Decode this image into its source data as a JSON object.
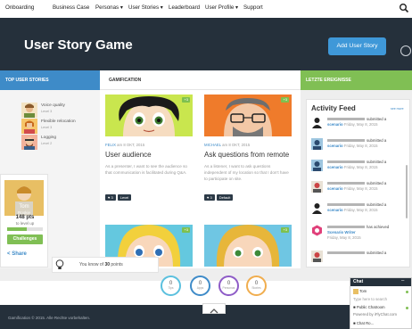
{
  "nav": {
    "items": [
      "Onboarding",
      "Business Case",
      "Personas ▾",
      "User Stories ▾",
      "Leaderboard",
      "User Profile ▾",
      "Support"
    ]
  },
  "header": {
    "title": "User Story Game",
    "add_button": "Add User Story"
  },
  "columns": {
    "left": "TOP USER STORIES",
    "middle": "GAMIFICATION",
    "right": "LETZTE EREIGNISSE"
  },
  "top_stories": [
    {
      "name": "Voice quality",
      "sub": "Level 3"
    },
    {
      "name": "Flexible relocation",
      "sub": "Level 3"
    },
    {
      "name": "Logging",
      "sub": "Level 2"
    }
  ],
  "profile": {
    "name": "Tom",
    "rank": "Rookie",
    "points": "148 pts",
    "points_sub": "to level up",
    "progress": 0.55,
    "challenges": "Challenges",
    "share": "Share"
  },
  "cards": [
    {
      "badge": "+3",
      "author": "FELIX",
      "date": "am 8 OKT, 2015",
      "title": "User audience",
      "desc": "As a presenter, I want to see the audience so that communication is facilitated during Q&A.",
      "pills": [
        "♥ 3",
        "Level"
      ]
    },
    {
      "badge": "+3",
      "author": "MICHAEL",
      "date": "am 8 OKT, 2015",
      "title": "Ask questions from remote",
      "desc": "As a listener, I want to ask questions independent of my location so that I don't have to participate on site.",
      "pills": [
        "♥ 3",
        "Default"
      ]
    },
    {
      "badge": "+3"
    },
    {
      "badge": "+3"
    }
  ],
  "feed": {
    "title": "Activity Feed",
    "see_all": "see more",
    "rows": [
      {
        "verb": "submitted",
        "tail": "a",
        "what": "scenario",
        "when": "Friday, May 8, 2015"
      },
      {
        "verb": "submitted",
        "tail": "a",
        "what": "scenario",
        "when": "Friday, May 8, 2015"
      },
      {
        "verb": "submitted",
        "tail": "a",
        "what": "scenario",
        "when": "Friday, May 8, 2015"
      },
      {
        "verb": "submitted",
        "tail": "a",
        "what": "scenario",
        "when": "Friday, May 8, 2015"
      },
      {
        "verb": "submitted",
        "tail": "a",
        "what": "scenario",
        "when": "Friday, May 8, 2015"
      },
      {
        "verb": "has achieved",
        "tail": "",
        "what": "Scenario Writer",
        "when": "Friday, May 8, 2015"
      },
      {
        "verb": "submitted",
        "tail": "a",
        "what": "",
        "when": ""
      }
    ]
  },
  "tooltip": {
    "prefix": "You know of",
    "value": "30",
    "suffix": "points"
  },
  "stats": [
    {
      "n": "0",
      "label": "Tips",
      "color": "#5bc0de"
    },
    {
      "n": "0",
      "label": "Apps",
      "color": "#3e8bc8"
    },
    {
      "n": "0",
      "label": "Personas",
      "color": "#8e5cc7"
    },
    {
      "n": "0",
      "label": "Stories",
      "color": "#f0ad4e"
    }
  ],
  "footer": {
    "copyright": "Gamification © 2015. Alle Rechte vorbehalten."
  },
  "chat": {
    "title": "Chat",
    "minimize": "–",
    "user": "Tom",
    "search": "Type here to search",
    "room": "Public Chatroom",
    "powered": "Powered by iFlyChat.com",
    "footer_text": "Chat Ro..."
  },
  "colors": {
    "header": "#25303b",
    "left_head": "#3e8bc8",
    "right_head": "#80bf54",
    "accent": "#3f98d8"
  },
  "icons": [
    "search-icon",
    "settings-icon",
    "share-icon",
    "bulb-icon",
    "chevron-up-icon"
  ]
}
